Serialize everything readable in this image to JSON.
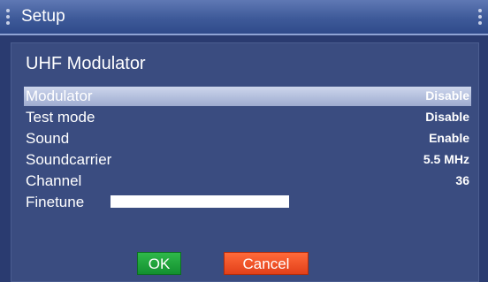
{
  "window": {
    "title": "Setup"
  },
  "panel": {
    "heading": "UHF Modulator"
  },
  "rows": [
    {
      "label": "Modulator",
      "value": "Disable"
    },
    {
      "label": "Test mode",
      "value": "Disable"
    },
    {
      "label": "Sound",
      "value": "Enable"
    },
    {
      "label": "Soundcarrier",
      "value": "5.5 MHz"
    },
    {
      "label": "Channel",
      "value": "36"
    },
    {
      "label": "Finetune",
      "value": "",
      "level": 1.0
    }
  ],
  "buttons": {
    "ok": "OK",
    "cancel": "Cancel"
  },
  "colors": {
    "background": "#2a3b70",
    "selected_row": "#b8c3e2",
    "ok_button": "#1fa63c",
    "cancel_button": "#f2502a"
  }
}
